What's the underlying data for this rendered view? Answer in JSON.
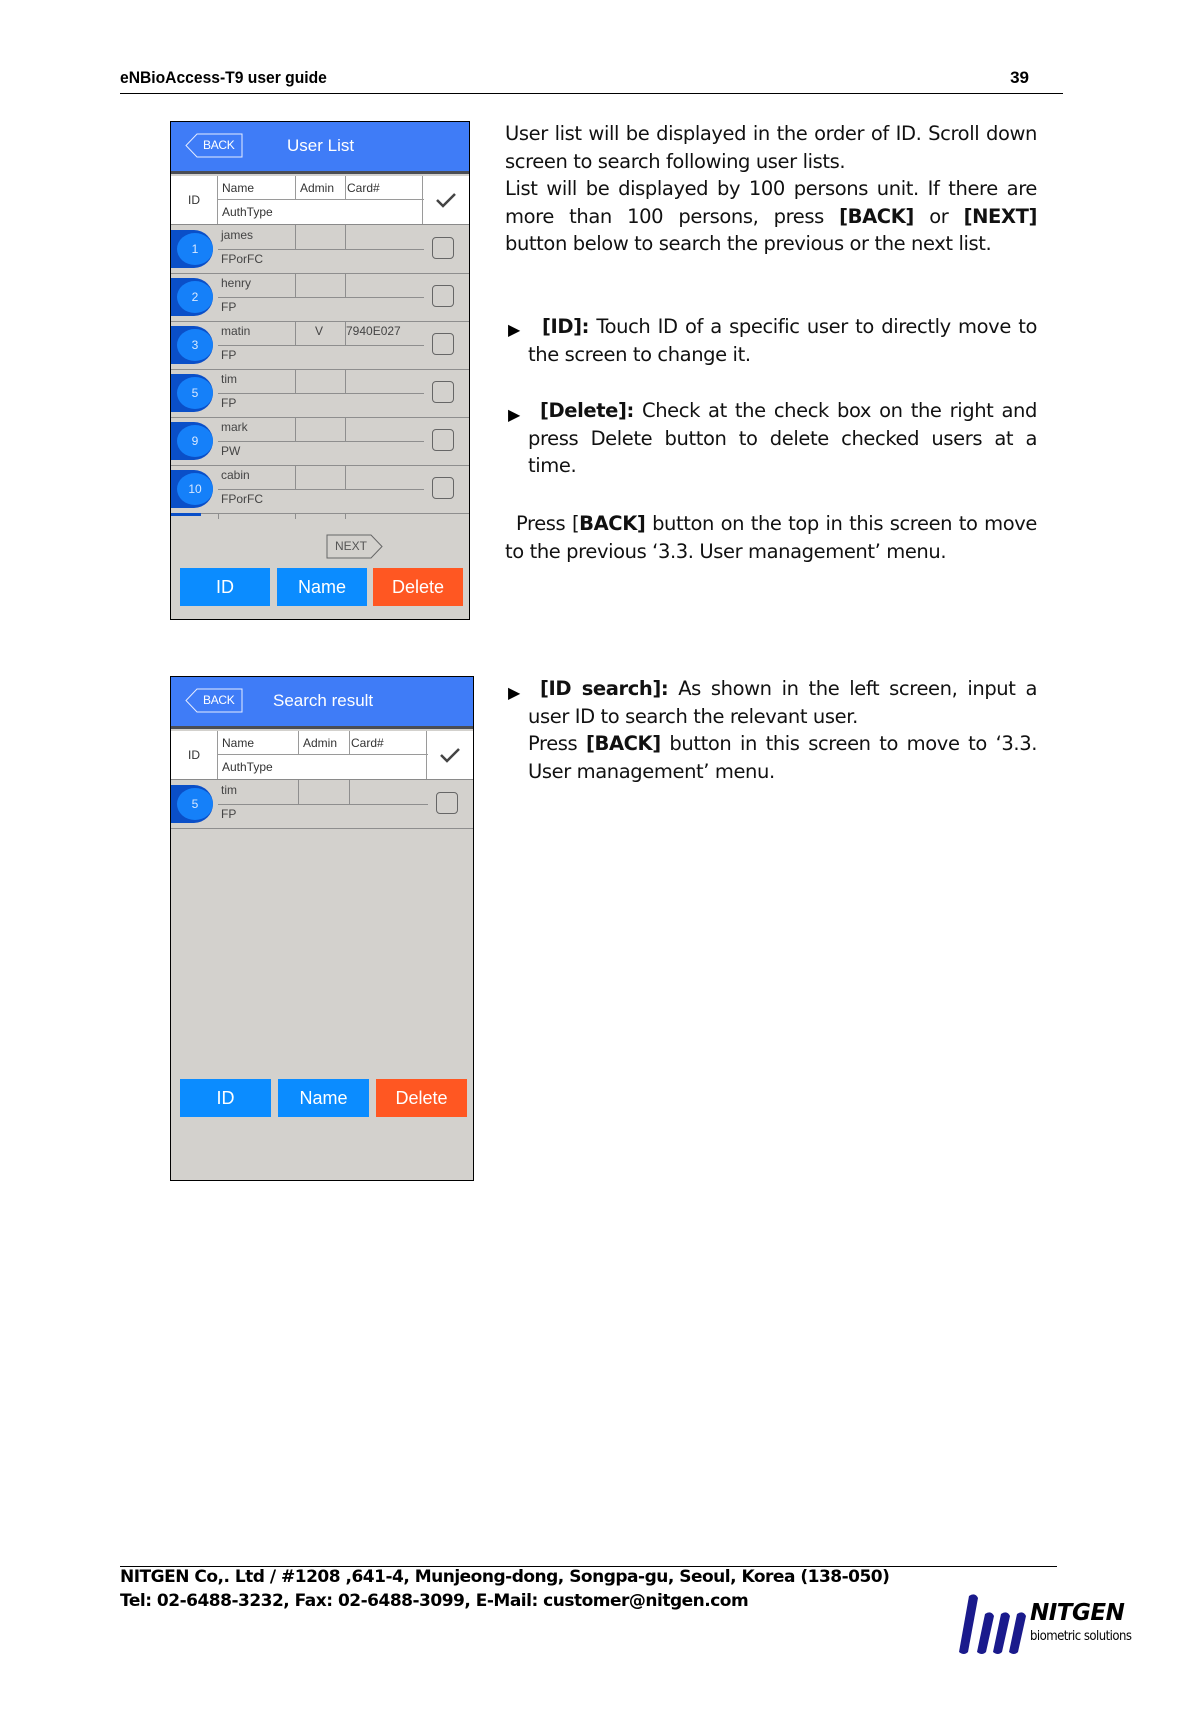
{
  "header": {
    "title": "eNBioAccess-T9 user guide",
    "page_number": "39"
  },
  "screen1": {
    "title": "User List",
    "back_label": "BACK",
    "columns": {
      "id": "ID",
      "name": "Name",
      "admin": "Admin",
      "card": "Card#",
      "authtype": "AuthType"
    },
    "rows": [
      {
        "id": "1",
        "name": "james",
        "admin": "",
        "card": "",
        "auth": "FPorFC"
      },
      {
        "id": "2",
        "name": "henry",
        "admin": "",
        "card": "",
        "auth": "FP"
      },
      {
        "id": "3",
        "name": "matin",
        "admin": "V",
        "card": "7940E027",
        "auth": "FP"
      },
      {
        "id": "5",
        "name": "tim",
        "admin": "",
        "card": "",
        "auth": "FP"
      },
      {
        "id": "9",
        "name": "mark",
        "admin": "",
        "card": "",
        "auth": "PW"
      },
      {
        "id": "10",
        "name": "cabin",
        "admin": "",
        "card": "",
        "auth": "FPorFC"
      }
    ],
    "next_label": "NEXT",
    "buttons": {
      "id": "ID",
      "name": "Name",
      "delete": "Delete"
    }
  },
  "screen2": {
    "title": "Search result",
    "back_label": "BACK",
    "columns": {
      "id": "ID",
      "name": "Name",
      "admin": "Admin",
      "card": "Card#",
      "authtype": "AuthType"
    },
    "rows": [
      {
        "id": "5",
        "name": "tim",
        "admin": "",
        "card": "",
        "auth": "FP"
      }
    ],
    "buttons": {
      "id": "ID",
      "name": "Name",
      "delete": "Delete"
    }
  },
  "text": {
    "intro1": "User list will be displayed in the order of ID. Scroll down screen to search following user lists.",
    "intro2_pre": "List will be displayed by 100 persons unit. If there are more than 100 persons, press ",
    "intro2_back": "[BACK]",
    "intro2_mid": " or ",
    "intro2_next": "[NEXT]",
    "intro2_post": " button below to search the previous or the next list.",
    "id_label": "[ID]:",
    "id_desc": " Touch ID of a specific user to directly move to the screen to change it.",
    "delete_label": "[Delete]:",
    "delete_desc": " Check at the check box on the right and press Delete button to delete checked users at a time.",
    "back_pre": "Press [",
    "back_label": "BACK]",
    "back_post": " button on the top in this screen to move to the previous ‘3.3. User management’ menu.",
    "idsearch_label": "[ID search]:",
    "idsearch_desc": " As shown in the left screen, input a user ID to search the relevant user.",
    "idsearch_press": "Press ",
    "idsearch_back": "[BACK]",
    "idsearch_post": " button in this screen to move to ‘3.3. User management’ menu.",
    "bullet": "▶"
  },
  "footer": {
    "line1": "NITGEN Co,. Ltd / #1208 ,641-4, Munjeong-dong, Songpa-gu, Seoul, Korea (138-050)",
    "line2": "Tel: 02-6488-3232, Fax: 02-6488-3099, E-Mail: customer@nitgen.com",
    "logo_brand": "NITGEN",
    "logo_tagline": "biometric solutions",
    "logo_color": "#1a1a8c"
  }
}
